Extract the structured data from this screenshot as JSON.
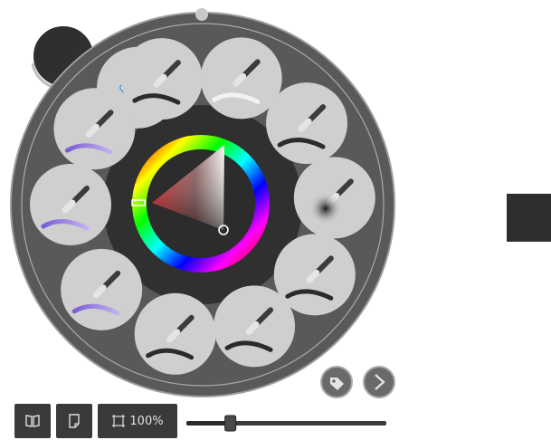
{
  "colors": {
    "wheel_outer": "#595959",
    "wheel_inner_ring": "#303030",
    "tool_slot": "#cfcfcf",
    "accent_swatch": "#2f2f2f",
    "ui_dark": "#3a3a3a"
  },
  "brush_wheel": {
    "tools": [
      {
        "name": "eraser",
        "icon": "eraser-icon"
      },
      {
        "name": "blender",
        "icon": "blender-icon"
      },
      {
        "name": "airbrush",
        "icon": "airbrush-icon"
      },
      {
        "name": "paintbrush",
        "icon": "paintbrush-icon"
      },
      {
        "name": "pencil",
        "icon": "pencil-icon"
      },
      {
        "name": "paint-roller",
        "icon": "fan-brush-icon"
      },
      {
        "name": "watercolor-flat",
        "icon": "watercolor-flat-brush-icon"
      },
      {
        "name": "watercolor-round",
        "icon": "watercolor-round-brush-icon"
      },
      {
        "name": "watercolor-wet",
        "icon": "wet-brush-icon"
      },
      {
        "name": "ballpoint",
        "icon": "ballpoint-pen-icon"
      }
    ],
    "nav_icon": "move-arrows-icon",
    "color_picker": {
      "hue_marker": "red",
      "selected": "#1a1a1a"
    }
  },
  "bottom_bar": {
    "book_icon": "book-icon",
    "page_icon": "page-icon",
    "zoom_label": "100%",
    "zoom_slider_value": 0.22
  },
  "right_swatch_color": "#2f2f2f"
}
